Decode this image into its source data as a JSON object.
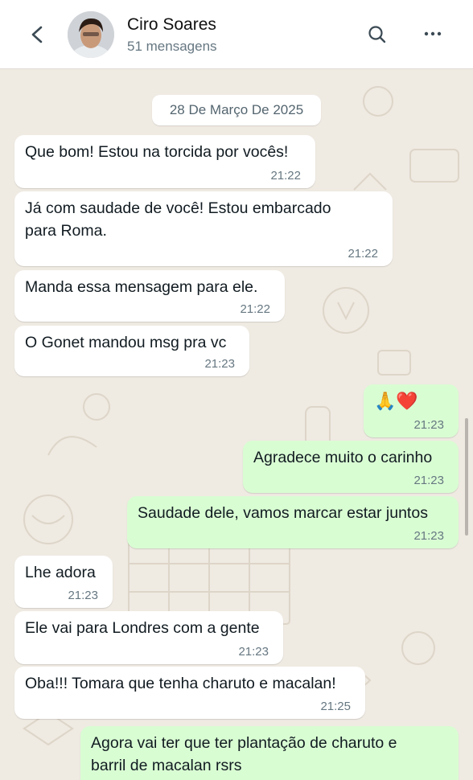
{
  "header": {
    "contact_name": "Ciro Soares",
    "subtitle": "51 mensagens",
    "icons": [
      "back-arrow-icon",
      "search-icon",
      "more-options-icon"
    ]
  },
  "chat": {
    "date_label": "28 De Março De 2025",
    "messages": [
      {
        "direction": "incoming",
        "lines": [
          "Que bom! Estou na torcida por vocês!"
        ],
        "time": "21:22"
      },
      {
        "direction": "incoming",
        "lines": [
          "Já com saudade de você! Estou embarcado",
          "para Roma."
        ],
        "time": "21:22"
      },
      {
        "direction": "incoming",
        "lines": [
          "Manda essa mensagem para ele."
        ],
        "time": "21:22"
      },
      {
        "direction": "incoming",
        "lines": [
          "O Gonet mandou msg pra vc"
        ],
        "time": "21:23"
      },
      {
        "direction": "outgoing",
        "lines": [
          "🙏❤️"
        ],
        "time": "21:23"
      },
      {
        "direction": "outgoing",
        "lines": [
          "Agradece muito o carinho"
        ],
        "time": "21:23"
      },
      {
        "direction": "outgoing",
        "lines": [
          "Saudade dele, vamos marcar estar juntos"
        ],
        "time": "21:23"
      },
      {
        "direction": "incoming",
        "lines": [
          "Lhe adora"
        ],
        "time": "21:23"
      },
      {
        "direction": "incoming",
        "lines": [
          "Ele vai para Londres com a gente"
        ],
        "time": "21:23"
      },
      {
        "direction": "incoming",
        "lines": [
          "Oba!!! Tomara que tenha charuto e macalan!"
        ],
        "time": "21:25"
      },
      {
        "direction": "outgoing",
        "lines": [
          "Agora vai ter que ter plantação de charuto e",
          "barril de macalan rsrs"
        ],
        "time": ""
      }
    ]
  },
  "colors": {
    "background": "#efeae2",
    "incoming_bubble": "#ffffff",
    "outgoing_bubble": "#d9fdd3",
    "timestamp": "#667781"
  }
}
